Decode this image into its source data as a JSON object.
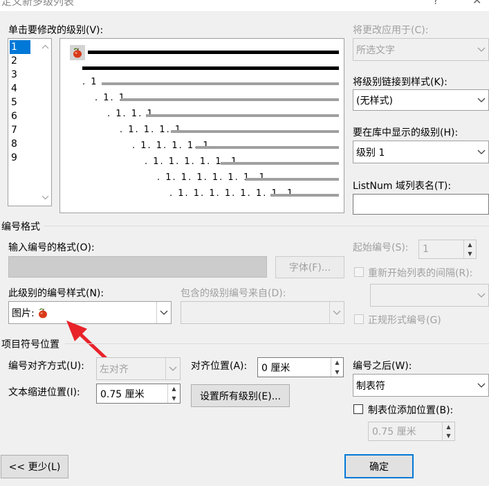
{
  "window": {
    "title": "定义新多级列表",
    "help": "?",
    "close": "✕"
  },
  "levels_section": {
    "label": "单击要修改的级别(V):",
    "levels": [
      "1",
      "2",
      "3",
      "4",
      "5",
      "6",
      "7",
      "8",
      "9"
    ],
    "selected": "1"
  },
  "preview": {
    "numbers": [
      ". 1",
      ". 1. 1",
      ". 1. 1. 1",
      ". 1. 1. 1. 1",
      ". 1. 1. 1. 1. 1",
      ". 1. 1. 1. 1. 1. 1",
      ". 1. 1. 1. 1. 1. 1. 1",
      ". 1. 1. 1. 1. 1. 1. 1. 1"
    ]
  },
  "right_panel": {
    "apply_to_label": "将更改应用于(C):",
    "apply_to_value": "所选文字",
    "link_style_label": "将级别链接到样式(K):",
    "link_style_value": "(无样式)",
    "gallery_level_label": "要在库中显示的级别(H):",
    "gallery_level_value": "级别 1",
    "listnum_label": "ListNum 域列表名(T):",
    "listnum_value": ""
  },
  "number_format": {
    "section_label": "编号格式",
    "enter_format_label": "输入编号的格式(O):",
    "font_button": "字体(F)...",
    "start_at_label": "起始编号(S):",
    "start_at_value": "1",
    "restart_label": "重新开始列表的间隔(R):",
    "restart_value": "",
    "style_label": "此级别的编号样式(N):",
    "style_value": "图片:",
    "include_from_label": "包含的级别编号来自(D):",
    "include_from_value": "",
    "legal_label": "正规形式编号(G)"
  },
  "position": {
    "section_label": "项目符号位置",
    "align_label": "编号对齐方式(U):",
    "align_value": "左对齐",
    "aligned_at_label": "对齐位置(A):",
    "aligned_at_value": "0 厘米",
    "indent_label": "文本缩进位置(I):",
    "indent_value": "0.75 厘米",
    "set_all_button": "设置所有级别(E)...",
    "follow_label": "编号之后(W):",
    "follow_value": "制表符",
    "add_tab_label": "制表位添加位置(B):",
    "add_tab_value": "0.75 厘米"
  },
  "footer": {
    "less_button": "<< 更少(L)",
    "ok_button": "确定"
  },
  "colors": {
    "accent": "#0078d7",
    "annotation_arrow": "#e8232a",
    "icon_apple": "#d83a1a"
  },
  "icons": [
    "apple-picture-bullet-icon",
    "chevron-down-icon",
    "spin-up-icon",
    "spin-down-icon",
    "scroll-up-icon",
    "scroll-down-icon",
    "annotation-arrow"
  ]
}
